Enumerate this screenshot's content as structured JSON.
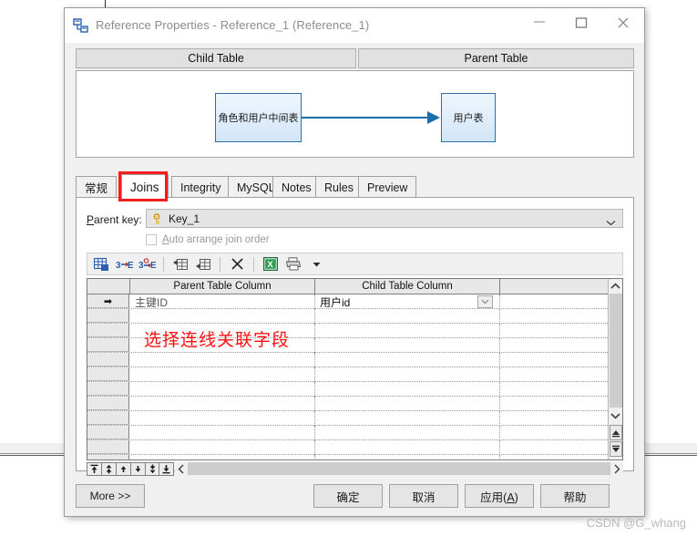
{
  "window": {
    "title": "Reference Properties - Reference_1 (Reference_1)",
    "icon": "reference-properties-icon",
    "minimize_label": "—",
    "maximize_label": "□",
    "close_label": "✕"
  },
  "preview": {
    "child_header": "Child Table",
    "parent_header": "Parent Table",
    "child_entity": "角色和用户中间表",
    "parent_entity": "用户表",
    "link_color": "#1a6fa8",
    "entity_border_color": "#2f6fa8"
  },
  "tabs": [
    {
      "label": "常规",
      "active": false
    },
    {
      "label": "Joins",
      "active": true
    },
    {
      "label": "Integrity",
      "active": false
    },
    {
      "label": "MySQL",
      "active": false
    },
    {
      "label": "Notes",
      "active": false
    },
    {
      "label": "Rules",
      "active": false
    },
    {
      "label": "Preview",
      "active": false
    }
  ],
  "tab_highlight": {
    "target": "Joins",
    "color": "#f41d1d"
  },
  "joins": {
    "parent_key_label": "Parent key:",
    "parent_key_accel": "P",
    "parent_key_value": "Key_1",
    "parent_key_icon": "key-icon",
    "auto_arrange_label": "Auto arrange join order",
    "auto_arrange_accel": "A",
    "auto_arrange_checked": false,
    "toolbar": [
      {
        "name": "select-columns-icon",
        "title": "Select Columns"
      },
      {
        "name": "auto-join-icon",
        "title": "Auto Join"
      },
      {
        "name": "auto-join-options-icon",
        "title": "Auto Join Options"
      },
      {
        "name": "insert-row-icon",
        "title": "Insert Row"
      },
      {
        "name": "add-row-icon",
        "title": "Add Row"
      },
      {
        "name": "delete-row-icon",
        "title": "Delete Row"
      },
      {
        "name": "export-excel-icon",
        "title": "Export to Excel"
      },
      {
        "name": "print-icon",
        "title": "Print"
      },
      {
        "name": "print-dropdown-icon",
        "title": "Print Options"
      }
    ],
    "grid": {
      "columns": [
        "",
        "Parent Table Column",
        "Child Table Column",
        ""
      ],
      "rows": [
        {
          "marker": "➡",
          "parent_column": "主键ID",
          "child_column": "用户id",
          "has_dropdown": true
        },
        {
          "marker": "",
          "parent_column": "",
          "child_column": "",
          "has_dropdown": false
        },
        {
          "marker": "",
          "parent_column": "",
          "child_column": "",
          "has_dropdown": false
        },
        {
          "marker": "",
          "parent_column": "",
          "child_column": "",
          "has_dropdown": false
        },
        {
          "marker": "",
          "parent_column": "",
          "child_column": "",
          "has_dropdown": false
        },
        {
          "marker": "",
          "parent_column": "",
          "child_column": "",
          "has_dropdown": false
        },
        {
          "marker": "",
          "parent_column": "",
          "child_column": "",
          "has_dropdown": false
        },
        {
          "marker": "",
          "parent_column": "",
          "child_column": "",
          "has_dropdown": false
        },
        {
          "marker": "",
          "parent_column": "",
          "child_column": "",
          "has_dropdown": false
        },
        {
          "marker": "",
          "parent_column": "",
          "child_column": "",
          "has_dropdown": false
        },
        {
          "marker": "",
          "parent_column": "",
          "child_column": "",
          "has_dropdown": false
        },
        {
          "marker": "",
          "parent_column": "",
          "child_column": "",
          "has_dropdown": false
        }
      ]
    },
    "row_nav": [
      {
        "name": "move-to-top-button",
        "glyph": "move-to-top-icon"
      },
      {
        "name": "move-up-fast-button",
        "glyph": "move-up-fast-icon"
      },
      {
        "name": "move-up-button",
        "glyph": "move-up-icon"
      },
      {
        "name": "move-down-button",
        "glyph": "move-down-icon"
      },
      {
        "name": "move-down-fast-button",
        "glyph": "move-down-fast-icon"
      },
      {
        "name": "move-to-bottom-button",
        "glyph": "move-to-bottom-icon"
      }
    ]
  },
  "annotation": {
    "text": "选择连线关联字段",
    "color": "#ff1010"
  },
  "footer": {
    "more": "More >>",
    "ok": "确定",
    "cancel": "取消",
    "apply_prefix": "应用(",
    "apply_accel": "A",
    "apply_suffix": ")",
    "help": "帮助"
  },
  "watermark": "CSDN @G_whang"
}
